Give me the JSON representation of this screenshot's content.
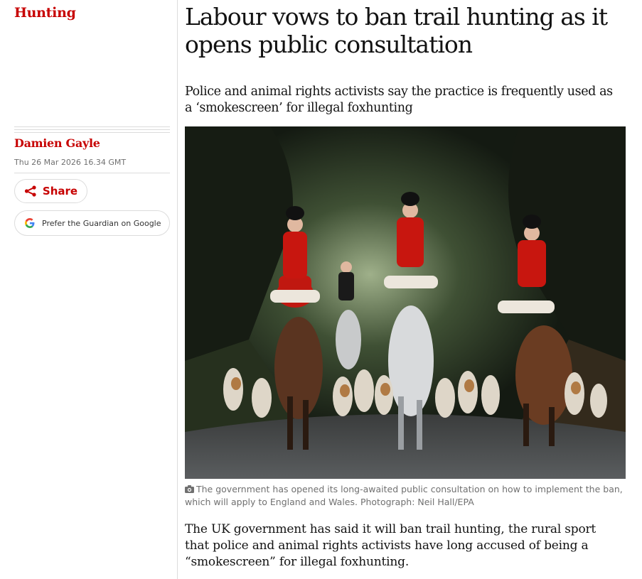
{
  "section": {
    "label": "Hunting"
  },
  "byline": {
    "author": "Damien Gayle",
    "date": "Thu 26 Mar 2026 16.34 GMT"
  },
  "actions": {
    "share_label": "Share",
    "google_label": "Prefer the Guardian on Google"
  },
  "article": {
    "headline": "Labour vows to ban trail hunting as it opens public consultation",
    "standfirst": "Police and animal rights activists say the practice is frequently used as a ‘smokescreen’ for illegal foxhunting",
    "image_alt": "Riders in red coats on horseback leading a pack of hounds down a tree-lined lane",
    "caption": "The government has opened its long-awaited public consultation on how to implement the ban, which will apply to England and Wales. Photograph: Neil Hall/EPA",
    "body": "The UK government has said it will ban trail hunting, the rural sport that police and animal rights activists have long accused of being a “smokescreen” for illegal foxhunting."
  },
  "colors": {
    "accent": "#c70000",
    "rule": "#dcdcdc",
    "muted": "#707070",
    "text": "#121212"
  }
}
